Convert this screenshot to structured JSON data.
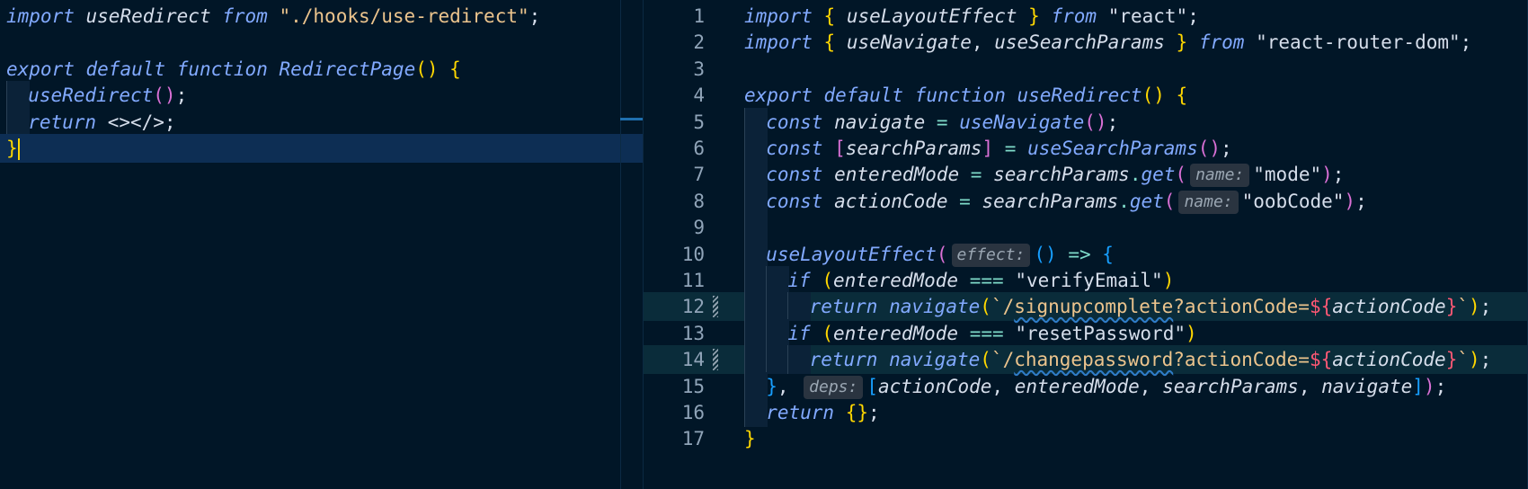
{
  "left_editor": {
    "file_label": "RedirectPage",
    "lines": [
      {
        "num": "",
        "tokens": [
          [
            "kwb",
            "import"
          ],
          [
            "punc",
            " "
          ],
          [
            "id",
            "useRedirect"
          ],
          [
            "punc",
            " "
          ],
          [
            "kwb",
            "from"
          ],
          [
            "punc",
            " "
          ],
          [
            "str",
            "\"./hooks/use-redirect\""
          ],
          [
            "punc",
            ";"
          ]
        ]
      },
      {
        "num": "",
        "tokens": []
      },
      {
        "num": "",
        "tokens": [
          [
            "kwb",
            "export"
          ],
          [
            "punc",
            " "
          ],
          [
            "kwb",
            "default"
          ],
          [
            "punc",
            " "
          ],
          [
            "kwb",
            "function"
          ],
          [
            "punc",
            " "
          ],
          [
            "fn",
            "RedirectPage"
          ],
          [
            "br",
            "()"
          ],
          [
            "punc",
            " "
          ],
          [
            "br",
            "{"
          ]
        ]
      },
      {
        "num": "",
        "guides": 1,
        "tokens": [
          [
            "fn",
            "useRedirect"
          ],
          [
            "brp",
            "()"
          ],
          [
            "punc",
            ";"
          ]
        ]
      },
      {
        "num": "",
        "guides": 1,
        "tokens": [
          [
            "kwb",
            "return"
          ],
          [
            "punc",
            " "
          ],
          [
            "punc",
            "<></>"
          ],
          [
            "punc",
            ";"
          ]
        ]
      },
      {
        "num": "",
        "active": true,
        "tokens": [
          [
            "br",
            "}"
          ]
        ]
      }
    ]
  },
  "right_editor": {
    "lines": [
      {
        "num": "1",
        "tokens": [
          [
            "kwb",
            "import"
          ],
          [
            "punc",
            " "
          ],
          [
            "br",
            "{"
          ],
          [
            "punc",
            " "
          ],
          [
            "id",
            "useLayoutEffect"
          ],
          [
            "punc",
            " "
          ],
          [
            "br",
            "}"
          ],
          [
            "punc",
            " "
          ],
          [
            "kwb",
            "from"
          ],
          [
            "punc",
            " "
          ],
          [
            "str2",
            "\"react\""
          ],
          [
            "punc",
            ";"
          ]
        ]
      },
      {
        "num": "2",
        "tokens": [
          [
            "kwb",
            "import"
          ],
          [
            "punc",
            " "
          ],
          [
            "br",
            "{"
          ],
          [
            "punc",
            " "
          ],
          [
            "id",
            "useNavigate"
          ],
          [
            "punc",
            ", "
          ],
          [
            "id",
            "useSearchParams"
          ],
          [
            "punc",
            " "
          ],
          [
            "br",
            "}"
          ],
          [
            "punc",
            " "
          ],
          [
            "kwb",
            "from"
          ],
          [
            "punc",
            " "
          ],
          [
            "str2",
            "\"react-router-dom\""
          ],
          [
            "punc",
            ";"
          ]
        ]
      },
      {
        "num": "3",
        "tokens": []
      },
      {
        "num": "4",
        "tokens": [
          [
            "kwb",
            "export"
          ],
          [
            "punc",
            " "
          ],
          [
            "kwb",
            "default"
          ],
          [
            "punc",
            " "
          ],
          [
            "kwb",
            "function"
          ],
          [
            "punc",
            " "
          ],
          [
            "fn",
            "useRedirect"
          ],
          [
            "br",
            "()"
          ],
          [
            "punc",
            " "
          ],
          [
            "br",
            "{"
          ]
        ]
      },
      {
        "num": "5",
        "guides": 1,
        "tokens": [
          [
            "kwb",
            "const"
          ],
          [
            "punc",
            " "
          ],
          [
            "id",
            "navigate"
          ],
          [
            "punc",
            " "
          ],
          [
            "op",
            "="
          ],
          [
            "punc",
            " "
          ],
          [
            "fn",
            "useNavigate"
          ],
          [
            "brp",
            "()"
          ],
          [
            "punc",
            ";"
          ]
        ]
      },
      {
        "num": "6",
        "guides": 1,
        "tokens": [
          [
            "kwb",
            "const"
          ],
          [
            "punc",
            " "
          ],
          [
            "brp",
            "["
          ],
          [
            "id",
            "searchParams"
          ],
          [
            "brp",
            "]"
          ],
          [
            "punc",
            " "
          ],
          [
            "op",
            "="
          ],
          [
            "punc",
            " "
          ],
          [
            "fn",
            "useSearchParams"
          ],
          [
            "brp",
            "()"
          ],
          [
            "punc",
            ";"
          ]
        ]
      },
      {
        "num": "7",
        "guides": 1,
        "tokens": [
          [
            "kwb",
            "const"
          ],
          [
            "punc",
            " "
          ],
          [
            "id",
            "enteredMode"
          ],
          [
            "punc",
            " "
          ],
          [
            "op",
            "="
          ],
          [
            "punc",
            " "
          ],
          [
            "id",
            "searchParams"
          ],
          [
            "op",
            "."
          ],
          [
            "fn",
            "get"
          ],
          [
            "brp",
            "("
          ],
          [
            "hint",
            "name:"
          ],
          [
            "str2",
            "\"mode\""
          ],
          [
            "brp",
            ")"
          ],
          [
            "punc",
            ";"
          ]
        ]
      },
      {
        "num": "8",
        "guides": 1,
        "tokens": [
          [
            "kwb",
            "const"
          ],
          [
            "punc",
            " "
          ],
          [
            "id",
            "actionCode"
          ],
          [
            "punc",
            " "
          ],
          [
            "op",
            "="
          ],
          [
            "punc",
            " "
          ],
          [
            "id",
            "searchParams"
          ],
          [
            "op",
            "."
          ],
          [
            "fn",
            "get"
          ],
          [
            "brp",
            "("
          ],
          [
            "hint",
            "name:"
          ],
          [
            "str2",
            "\"oobCode\""
          ],
          [
            "brp",
            ")"
          ],
          [
            "punc",
            ";"
          ]
        ]
      },
      {
        "num": "9",
        "guides": 1,
        "tokens": []
      },
      {
        "num": "10",
        "guides": 1,
        "tokens": [
          [
            "fn",
            "useLayoutEffect"
          ],
          [
            "brp",
            "("
          ],
          [
            "hint",
            "effect:"
          ],
          [
            "brb",
            "()"
          ],
          [
            "punc",
            " "
          ],
          [
            "op",
            "=>"
          ],
          [
            "punc",
            " "
          ],
          [
            "brb",
            "{"
          ]
        ]
      },
      {
        "num": "11",
        "guides": 2,
        "tokens": [
          [
            "kwb",
            "if"
          ],
          [
            "punc",
            " "
          ],
          [
            "br",
            "("
          ],
          [
            "id",
            "enteredMode"
          ],
          [
            "punc",
            " "
          ],
          [
            "op",
            "==="
          ],
          [
            "punc",
            " "
          ],
          [
            "str2",
            "\"verifyEmail\""
          ],
          [
            "br",
            ")"
          ]
        ]
      },
      {
        "num": "12",
        "guides": 3,
        "hl": true,
        "mod": true,
        "tokens": [
          [
            "kwb",
            "return"
          ],
          [
            "punc",
            " "
          ],
          [
            "fn",
            "navigate"
          ],
          [
            "br",
            "("
          ],
          [
            "tpl",
            "`/"
          ],
          [
            "tplu",
            "signupcomplete"
          ],
          [
            "tpl",
            "?actionCode="
          ],
          [
            "tplv",
            "${"
          ],
          [
            "id",
            "actionCode"
          ],
          [
            "tplv",
            "}"
          ],
          [
            "tpl",
            "`"
          ],
          [
            "br",
            ")"
          ],
          [
            "punc",
            ";"
          ]
        ]
      },
      {
        "num": "13",
        "guides": 2,
        "tokens": [
          [
            "kwb",
            "if"
          ],
          [
            "punc",
            " "
          ],
          [
            "br",
            "("
          ],
          [
            "id",
            "enteredMode"
          ],
          [
            "punc",
            " "
          ],
          [
            "op",
            "==="
          ],
          [
            "punc",
            " "
          ],
          [
            "str2",
            "\"resetPassword\""
          ],
          [
            "br",
            ")"
          ]
        ]
      },
      {
        "num": "14",
        "guides": 3,
        "hl": true,
        "mod": true,
        "tokens": [
          [
            "kwb",
            "return"
          ],
          [
            "punc",
            " "
          ],
          [
            "fn",
            "navigate"
          ],
          [
            "br",
            "("
          ],
          [
            "tpl",
            "`/"
          ],
          [
            "tplu",
            "changepassword"
          ],
          [
            "tpl",
            "?actionCode="
          ],
          [
            "tplv",
            "${"
          ],
          [
            "id",
            "actionCode"
          ],
          [
            "tplv",
            "}"
          ],
          [
            "tpl",
            "`"
          ],
          [
            "br",
            ")"
          ],
          [
            "punc",
            ";"
          ]
        ]
      },
      {
        "num": "15",
        "guides": 1,
        "tokens": [
          [
            "brb",
            "}"
          ],
          [
            "punc",
            ", "
          ],
          [
            "hint",
            "deps:"
          ],
          [
            "brb",
            "["
          ],
          [
            "id",
            "actionCode"
          ],
          [
            "punc",
            ", "
          ],
          [
            "id",
            "enteredMode"
          ],
          [
            "punc",
            ", "
          ],
          [
            "id",
            "searchParams"
          ],
          [
            "punc",
            ", "
          ],
          [
            "id",
            "navigate"
          ],
          [
            "brb",
            "]"
          ],
          [
            "brp",
            ")"
          ],
          [
            "punc",
            ";"
          ]
        ]
      },
      {
        "num": "16",
        "guides": 1,
        "tokens": [
          [
            "kwb",
            "return"
          ],
          [
            "punc",
            " "
          ],
          [
            "br",
            "{}"
          ],
          [
            "punc",
            ";"
          ]
        ]
      },
      {
        "num": "17",
        "tokens": [
          [
            "br",
            "}"
          ]
        ]
      }
    ]
  },
  "colors": {
    "background": "#011627",
    "keyword": "#82aaff",
    "string": "#ecc48d",
    "bracket_gold": "#ffd700",
    "bracket_pink": "#da70d6",
    "bracket_blue": "#179fff"
  }
}
